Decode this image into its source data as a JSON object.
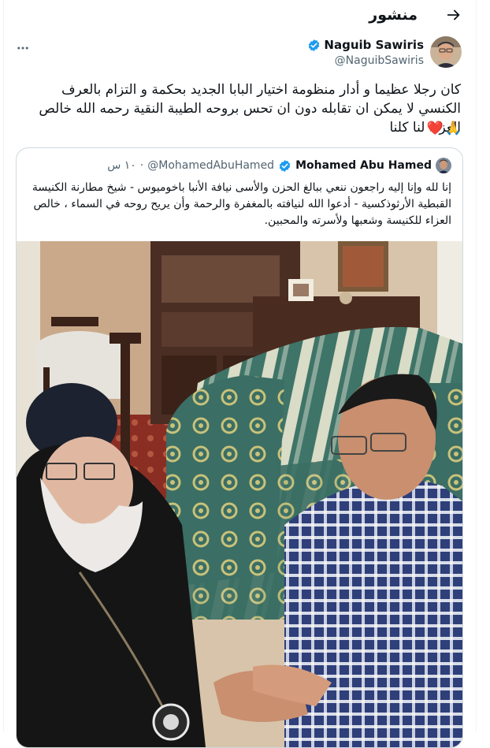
{
  "header": {
    "title": "منشور",
    "back_icon": "arrow-right-icon"
  },
  "author": {
    "name": "Naguib Sawiris",
    "handle": "@NaguibSawiris",
    "verified": true,
    "verified_color": "#1d9bf0"
  },
  "tweet": {
    "text": "كان رجلا عظيما و أدار منظومة اختيار البابا الجديد بحكمة و التزام بالعرف الكنسي لا يمكن ان تقابله دون ان تحس بروحه الطيبة النقية رحمه الله خالص العزاء لنا كلنا",
    "emoji": [
      "🙏",
      "❤️"
    ]
  },
  "quote": {
    "name": "Mohamed Abu Hamed",
    "handle": "@MohamedAbuHamed",
    "time": "١٠ س",
    "verified": true,
    "text": "إنا لله وإنا إليه راجعون ننعي ببالغ الحزن والأسى نيافة الأنبا باخوميوس - شيخ مطارنة الكنيسة القبطية الأرثوذكسية - أدعوا الله لنيافته بالمغفرة والرحمة وأن يريح روحه في السماء ، خالص العزاء للكنيسة وشعبها ولأسرته والمحبين."
  },
  "colors": {
    "text": "#0f1419",
    "secondary": "#536471",
    "border": "#cfd9de",
    "accent": "#1d9bf0"
  }
}
